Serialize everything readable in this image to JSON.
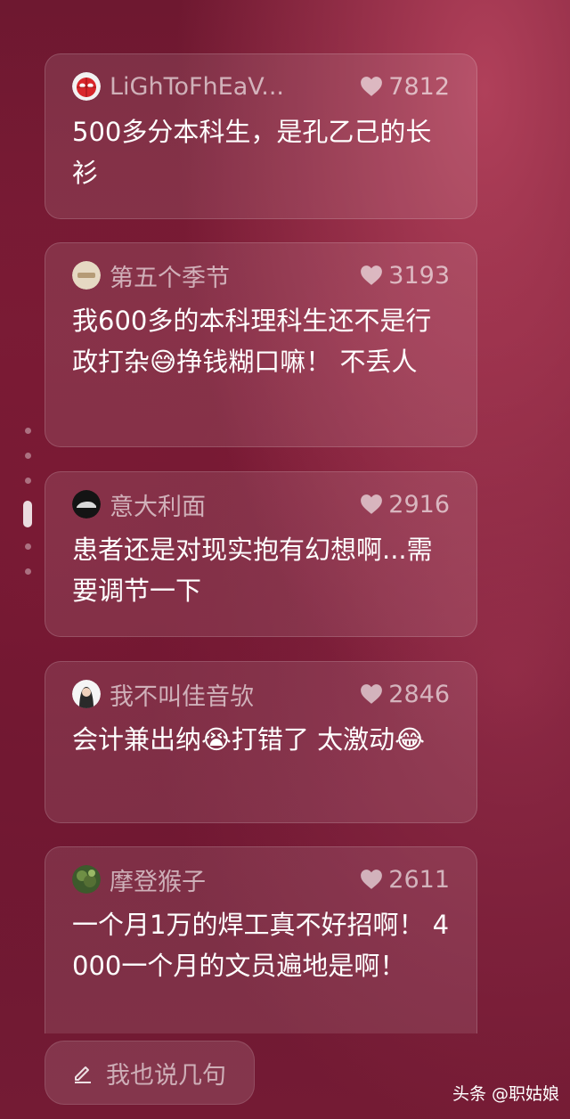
{
  "comments": [
    {
      "username": "LiGhToFhEaV...",
      "likes": "7812",
      "text": "500多分本科生，是孔乙己的长衫",
      "avatar_icon": "spiderman-avatar-icon"
    },
    {
      "username": "第五个季节",
      "likes": "3193",
      "text": "我600多的本科理科生还不是行政打杂😅挣钱糊口嘛！ 不丢人",
      "avatar_icon": "badge-avatar-icon"
    },
    {
      "username": "意大利面",
      "likes": "2916",
      "text": "患者还是对现实抱有幻想啊...需要调节一下",
      "avatar_icon": "car-avatar-icon"
    },
    {
      "username": "我不叫佳音欤",
      "likes": "2846",
      "text": "会计兼出纳😭打错了 太激动😂",
      "avatar_icon": "portrait-avatar-icon"
    },
    {
      "username": "摩登猴子",
      "likes": "2611",
      "text": "一个月1万的焊工真不好招啊！ 4000一个月的文员遍地是啊！",
      "avatar_icon": "tree-avatar-icon"
    }
  ],
  "composer": {
    "placeholder": "我也说几句",
    "icon": "pen-icon"
  },
  "watermark": "头条 @职姑娘",
  "colors": {
    "background": "#6e1830",
    "card": "rgba(255,255,255,0.10)",
    "muted_text": "rgba(255,255,255,0.62)"
  }
}
